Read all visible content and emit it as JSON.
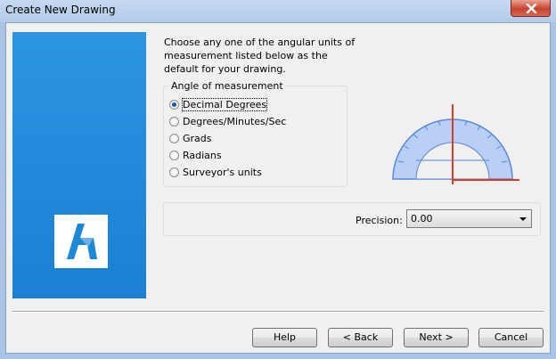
{
  "window": {
    "title": "Create New Drawing"
  },
  "instructions": "Choose any one of the angular units of measurement listed below as the default for your drawing.",
  "angle_group": {
    "legend": "Angle of measurement",
    "options": [
      {
        "label": "Decimal Degrees",
        "checked": true
      },
      {
        "label": "Degrees/Minutes/Sec",
        "checked": false
      },
      {
        "label": "Grads",
        "checked": false
      },
      {
        "label": "Radians",
        "checked": false
      },
      {
        "label": "Surveyor's units",
        "checked": false
      }
    ]
  },
  "precision": {
    "label": "Precision:",
    "value": "0.00"
  },
  "buttons": {
    "help": "Help",
    "back": "< Back",
    "next": "Next >",
    "cancel": "Cancel"
  },
  "colors": {
    "brand_blue": "#1e88d8",
    "protractor": "#6e9be6",
    "guide_red": "#d93a2a"
  },
  "icons": [
    "close-icon",
    "bricscad-logo-icon",
    "protractor-icon",
    "dropdown-arrow-icon"
  ]
}
